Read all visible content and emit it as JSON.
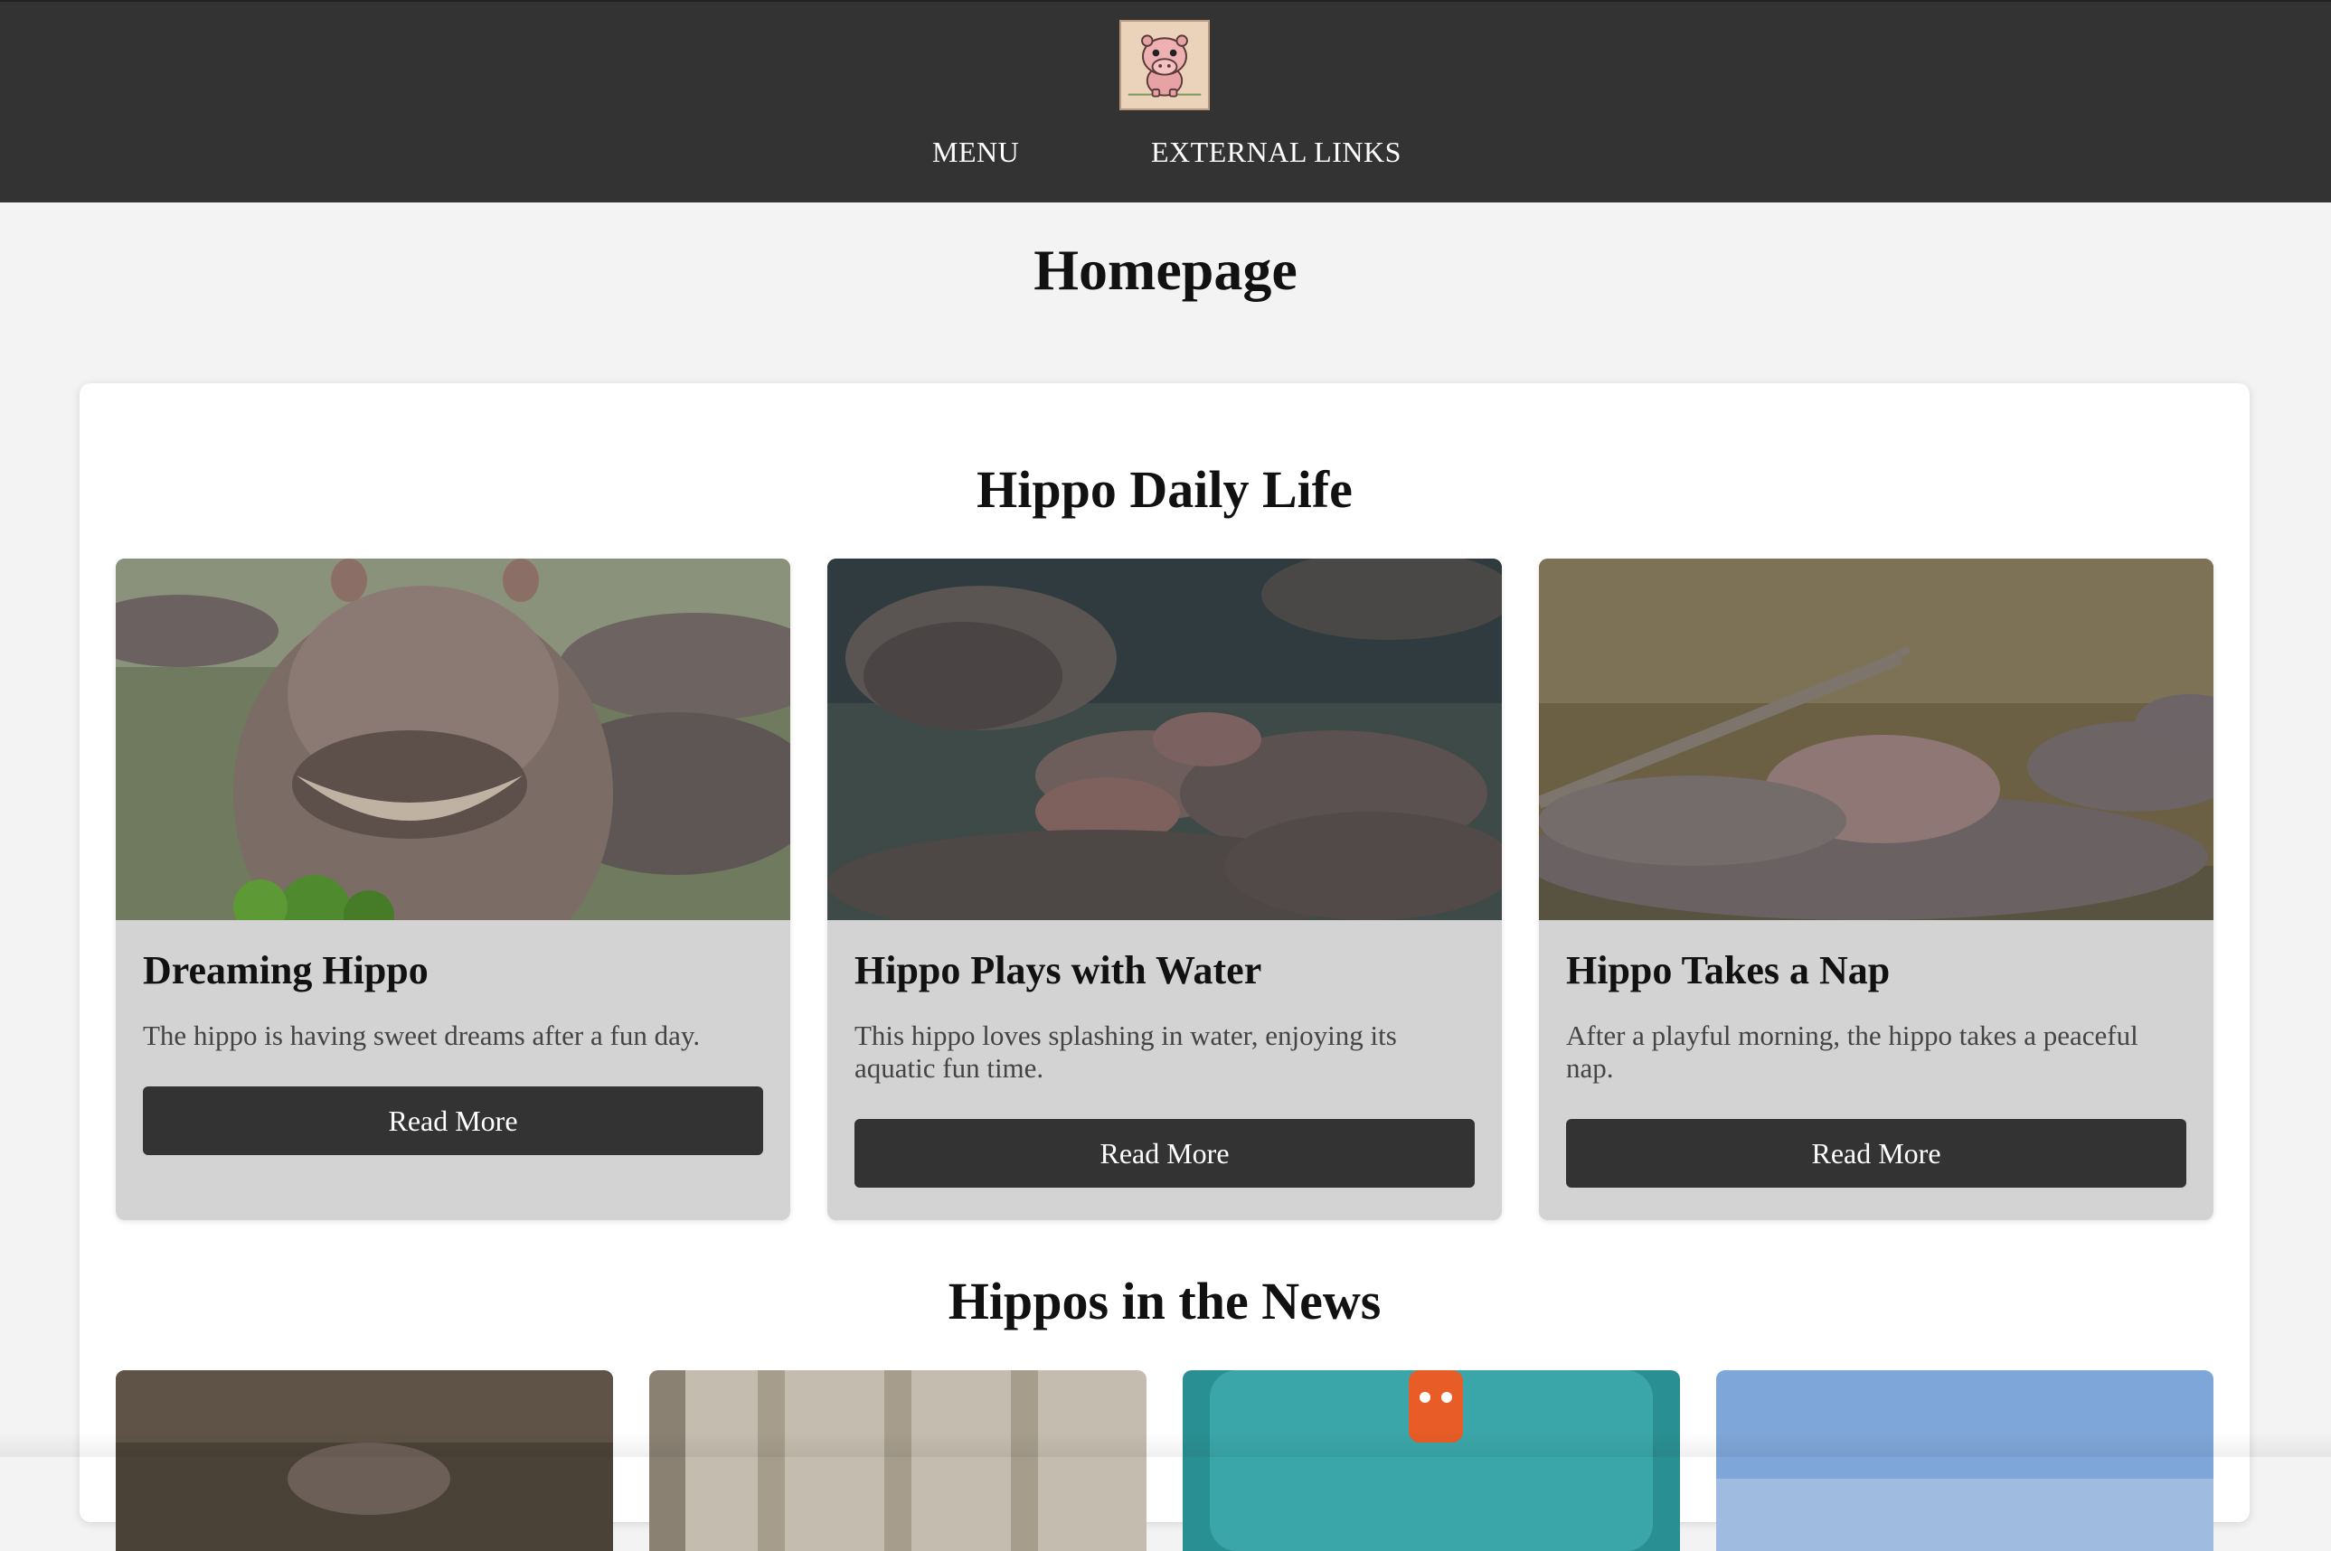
{
  "header": {
    "logo_alt": "Hippo logo",
    "nav": {
      "menu_label": "MENU",
      "external_label": "EXTERNAL LINKS"
    }
  },
  "page": {
    "title": "Homepage"
  },
  "daily_life": {
    "title": "Hippo Daily Life",
    "cards": [
      {
        "title": "Dreaming Hippo",
        "text": "The hippo is having sweet dreams after a fun day.",
        "button_label": "Read More"
      },
      {
        "title": "Hippo Plays with Water",
        "text": "This hippo loves splashing in water, enjoying its aquatic fun time.",
        "button_label": "Read More"
      },
      {
        "title": "Hippo Takes a Nap",
        "text": "After a playful morning, the hippo takes a peaceful nap.",
        "button_label": "Read More"
      }
    ]
  },
  "news": {
    "title": "Hippos in the News"
  },
  "colors": {
    "header_bg": "#333333",
    "page_bg": "#f3f3f3",
    "card_bg": "#d3d3d3",
    "button_bg": "#333333",
    "button_text": "#ffffff"
  }
}
